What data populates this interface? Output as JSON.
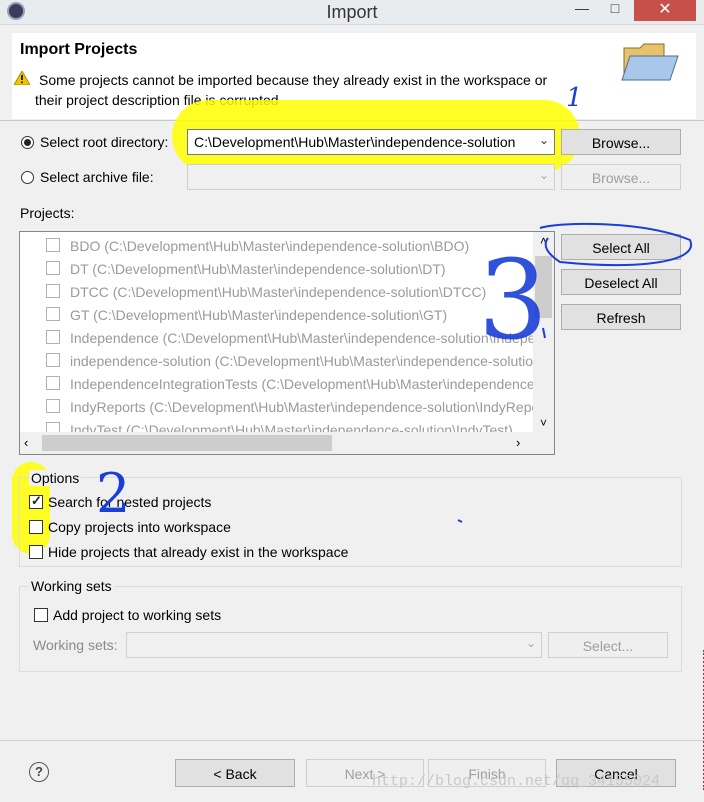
{
  "window": {
    "title": "Import",
    "min_label": "—",
    "max_label": "□",
    "close_label": "✕"
  },
  "header": {
    "title": "Import Projects",
    "warning_line1": "Some projects cannot be imported because they already exist in the workspace or",
    "warning_line2": "their project description file is corrupted"
  },
  "source": {
    "root_label": "Select root directory:",
    "root_value": "C:\\Development\\Hub\\Master\\independence-solution",
    "browse1": "Browse...",
    "archive_label": "Select archive file:",
    "archive_value": "",
    "browse2": "Browse..."
  },
  "projects": {
    "label": "Projects:",
    "items": [
      "BDO (C:\\Development\\Hub\\Master\\independence-solution\\BDO)",
      "DT (C:\\Development\\Hub\\Master\\independence-solution\\DT)",
      "DTCC (C:\\Development\\Hub\\Master\\independence-solution\\DTCC)",
      "GT (C:\\Development\\Hub\\Master\\independence-solution\\GT)",
      "Independence (C:\\Development\\Hub\\Master\\independence-solution\\Independence)",
      "independence-solution (C:\\Development\\Hub\\Master\\independence-solution)",
      "IndependenceIntegrationTests (C:\\Development\\Hub\\Master\\independence-solution\\IndependenceIntegrationTests)",
      "IndyReports (C:\\Development\\Hub\\Master\\independence-solution\\IndyReports)",
      "IndyTest (C:\\Development\\Hub\\Master\\independence-solution\\IndyTest)"
    ],
    "select_all": "Select All",
    "deselect_all": "Deselect All",
    "refresh": "Refresh"
  },
  "options": {
    "label": "Options",
    "search_nested": "Search for nested projects",
    "copy_projects": "Copy projects into workspace",
    "hide_existing": "Hide projects that already exist in the workspace"
  },
  "working_sets": {
    "label": "Working sets",
    "add_label": "Add project to working sets",
    "sets_label": "Working sets:",
    "select_button": "Select..."
  },
  "footer": {
    "help": "?",
    "back": "< Back",
    "next": "Next >",
    "finish": "Finish",
    "cancel": "Cancel"
  },
  "annotations": {
    "one": "1",
    "two": "2",
    "three": "3"
  },
  "watermark": "http://blog.csdn.net/qq_34155024",
  "colors": {
    "highlight": "#ffff00",
    "pen": "#1a3fd6",
    "close_red": "#c7504a"
  }
}
